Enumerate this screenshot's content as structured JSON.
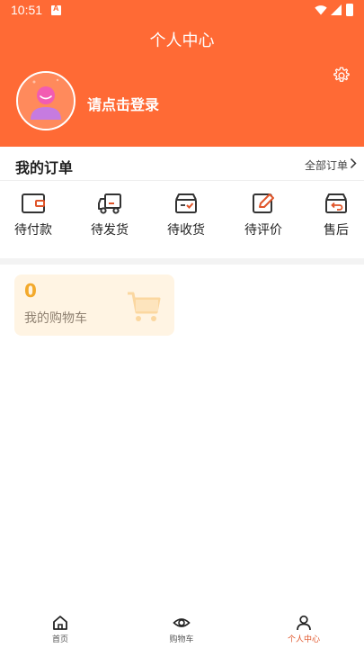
{
  "status_bar": {
    "time": "10:51"
  },
  "header": {
    "title": "个人中心",
    "login_prompt": "请点击登录"
  },
  "orders": {
    "title": "我的订单",
    "all_link": "全部订单",
    "items": [
      {
        "label": "待付款",
        "icon": "wallet-icon"
      },
      {
        "label": "待发货",
        "icon": "truck-icon"
      },
      {
        "label": "待收货",
        "icon": "receive-box-icon"
      },
      {
        "label": "待评价",
        "icon": "edit-icon"
      },
      {
        "label": "售后",
        "icon": "return-box-icon"
      }
    ]
  },
  "cart_card": {
    "count": "0",
    "label": "我的购物车"
  },
  "tabbar": {
    "items": [
      {
        "label": "首页",
        "icon": "home-icon"
      },
      {
        "label": "购物车",
        "icon": "eye-icon"
      },
      {
        "label": "个人中心",
        "icon": "person-icon"
      }
    ],
    "active_index": 2
  },
  "colors": {
    "accent": "#ff6a35",
    "active_tab": "#e0552a",
    "cart_card_bg": "#fff4e3",
    "cart_count": "#f3a92b"
  }
}
